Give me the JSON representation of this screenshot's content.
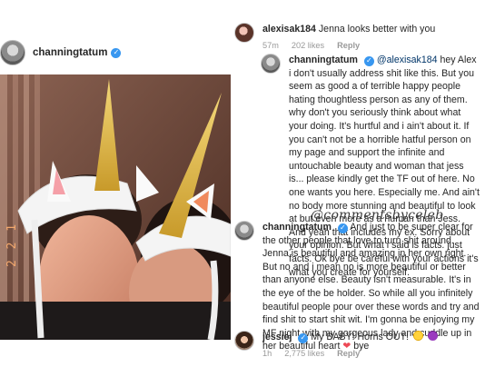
{
  "post": {
    "username": "channingtatum",
    "verified_icon": "verified-badge-icon",
    "photo_date_stamp": "2 2 1"
  },
  "comments": [
    {
      "username": "alexisak184",
      "text": "Jenna looks better with you",
      "time": "57m",
      "likes": "202 likes",
      "reply": "Reply"
    },
    {
      "username": "channingtatum",
      "mention": "@alexisak184",
      "text": "hey Alex i don't usually address shit like this. But you seem as good a of terrible happy people hating thoughtless person as any of them. why don't you seriously think about what your doing. It's hurtful and i ain't about it. If you can't not be a horrible hatful person on my page and support the infinite and untouchable beauty and woman that jess is... please kindly get the TF out of here. No one wants you here. Especially me. And ain't no body more stunning and beautiful to look at but even more as a human than Jess. And yeah that includes my ex. Sorry about your opinion. But what i said is facts. just facts. Ok bye be careful with your actions it's what you create for yourself."
    },
    {
      "username": "channingtatum",
      "text": "And just to be super clear for the other people that love to turn shit around. Jenna is beautiful and amazing in her own right. But no and i mean no is more beautiful or better than anyone else. Beauty isn't measurable. It's in the eye of the be holder. So while all you infinitely beautiful people pour over these words and try and find shit to start shit wit. I'm gonna be enjoying my MF night with my gorgeous lady and cuddle up in her beautiful heart",
      "heart": "❤",
      "tail": "bye"
    },
    {
      "username": "jessiej",
      "text": "My BABY! Horns OUT!",
      "time": "1h",
      "likes": "2,775 likes",
      "reply": "Reply"
    }
  ],
  "watermark": "@commentsbyceleb"
}
